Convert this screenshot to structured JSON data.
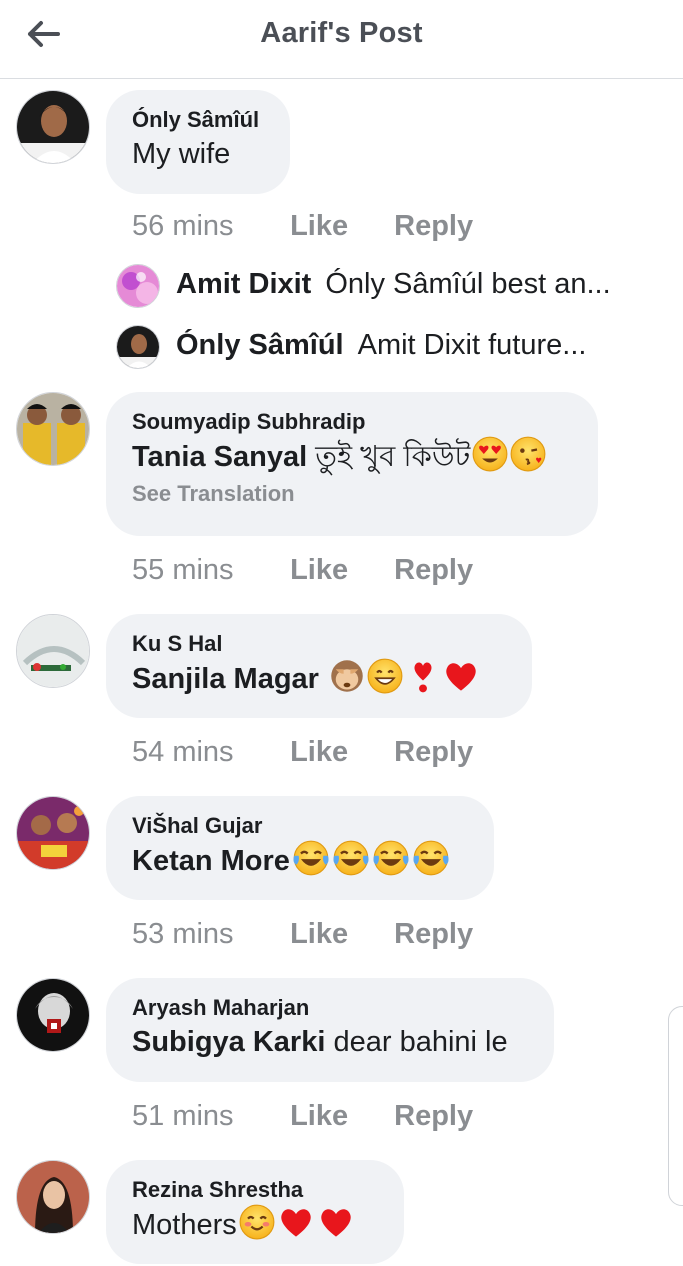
{
  "header": {
    "title": "Aarif's Post"
  },
  "comments": [
    {
      "author": "Ónly Sâmîúl",
      "text": "My wife",
      "time": "56 mins",
      "like": "Like",
      "reply": "Reply"
    },
    {
      "author": "Soumyadip Subhradip",
      "mention": "Tania Sanyal",
      "text": "তুই খুব কিউট",
      "emojis": [
        "heart-eyes-emoji",
        "kiss-emoji"
      ],
      "see_translation": "See Translation",
      "time": "55 mins",
      "like": "Like",
      "reply": "Reply"
    },
    {
      "author": "Ku S Hal",
      "mention": "Sanjila Magar",
      "emojis": [
        "see-no-evil-emoji",
        "grin-emoji",
        "exclamation-heart-emoji",
        "red-heart-emoji"
      ],
      "time": "54 mins",
      "like": "Like",
      "reply": "Reply"
    },
    {
      "author": "ViŠhal Gujar",
      "mention": "Ketan More",
      "emojis": [
        "tears-of-joy-emoji",
        "tears-of-joy-emoji",
        "tears-of-joy-emoji",
        "tears-of-joy-emoji"
      ],
      "time": "53 mins",
      "like": "Like",
      "reply": "Reply"
    },
    {
      "author": "Aryash Maharjan",
      "mention": "Subigya Karki",
      "text": "dear bahini le",
      "time": "51 mins",
      "like": "Like",
      "reply": "Reply"
    },
    {
      "author": "Rezina Shrestha",
      "text": "Mothers",
      "emojis": [
        "blush-emoji",
        "red-heart-emoji",
        "red-heart-emoji"
      ]
    }
  ],
  "replies": [
    {
      "author": "Amit Dixit",
      "text": "Ónly Sâmîúl best an..."
    },
    {
      "author": "Ónly Sâmîúl",
      "text": "Amit Dixit future..."
    }
  ],
  "colors": {
    "meta": "#8a8d91",
    "bubble": "#f0f2f5",
    "text": "#1c1e21",
    "title": "#4b4f56"
  }
}
